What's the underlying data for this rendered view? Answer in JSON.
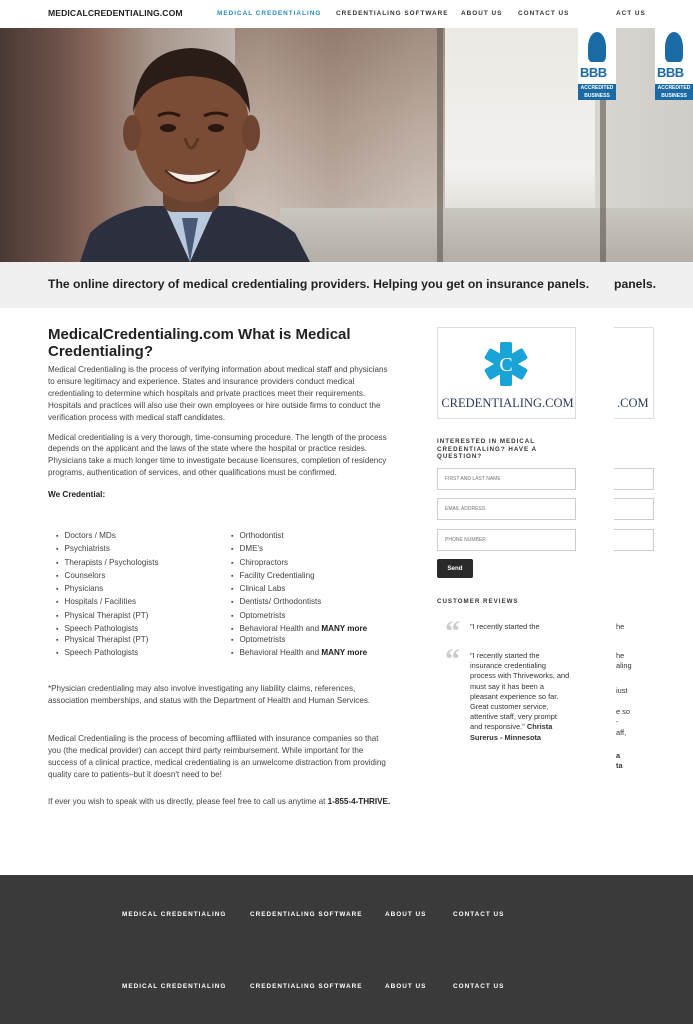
{
  "nav": {
    "brand": "MEDICALCREDENTIALING.COM",
    "links": [
      "MEDICAL CREDENTIALING",
      "CREDENTIALING SOFTWARE",
      "ABOUT US",
      "CONTACT US"
    ],
    "dup_link": "ACT US"
  },
  "hero": {
    "bbb_letters": "BBB",
    "bbb_accredited": "ACCREDITED",
    "bbb_business": "BUSINESS"
  },
  "tagline": "The online directory of medical credentialing providers. Helping you get on insurance panels.",
  "tagline_dup": "panels.",
  "main": {
    "title": "MedicalCredentialing.com What is Medical Credentialing?",
    "para1": "Medical Credentialing is the process of verifying information about medical staff and physicians to ensure legitimacy and experience. States and insurance providers conduct medical credentialing to determine which hospitals and private practices meet their requirements. Hospitals and practices will also use their own employees or hire outside firms to conduct the verification process with medical staff candidates.",
    "para2": "Medical credentialing is a very thorough, time-consuming procedure. The length of the process depends on the applicant and the laws of the state where the hospital or practice resides. Physicians take a much longer time to investigate because licensures, completion of residency programs, authentication of services, and other qualifications must be confirmed.",
    "we_credential": "We Credential:",
    "list_left": [
      "Doctors / MDs",
      "Psychiatrists",
      "Therapists / Psychologists",
      "Counselors",
      "Physicians",
      "Hospitals / Facilities",
      "Physical Therapist (PT)",
      "Speech Pathologists"
    ],
    "list_right": [
      "Orthodontist",
      "DME's",
      "Chiropractors",
      "Facility Credentialing",
      "Clinical Labs",
      "Dentists/ Orthodontists",
      "Optometrists",
      "Behavioral Health and "
    ],
    "list_left2": [
      "Physical Therapist (PT)",
      "Speech Pathologists"
    ],
    "list_right2": [
      "Optometrists",
      "Behavioral Health and "
    ],
    "many_more": "MANY more",
    "para3": "*Physician credentialing may also involve investigating any liability claims, references, association memberships, and status with the Department of Health and Human Services.",
    "para4": "Medical Credentialing is the process of becoming affiliated with insurance companies so that you (the medical provider) can accept third party reimbursement. While important for the success of a clinical practice, medical credentialing is an unwelcome distraction from providing quality care to patients–but it doesn't need to be!",
    "para5_prefix": "If ever you wish to speak with us directly, please feel free to call us anytime at ",
    "phone": "1-855-4-THRIVE."
  },
  "sidebar": {
    "logo_text": "CREDENTIALING.COM",
    "logo_dup": ".COM",
    "form_heading": "INTERESTED IN MEDICAL CREDENTIALING? HAVE A QUESTION?",
    "name_placeholder": "FIRST AND LAST NAME",
    "email_placeholder": "EMAIL ADDRESS",
    "phone_placeholder": "PHONE NUMBER",
    "send_label": "Send",
    "reviews_heading": "CUSTOMER REVIEWS",
    "review_short": "\"I recently started the",
    "review_full": "\"I recently started the insurance credentialing process with Thriveworks, and must say it has been a pleasant experience so far. Great customer service, attentive staff, very prompt and responsive.\"",
    "review_author": "Christa Surerus - Minnesota",
    "dup_lines": [
      "he",
      "he",
      "aling",
      "iust",
      "e so",
      "-",
      "aff,",
      "a",
      "ta"
    ]
  },
  "footer": {
    "links": [
      "MEDICAL CREDENTIALING",
      "CREDENTIALING SOFTWARE",
      "ABOUT US",
      "CONTACT US"
    ]
  },
  "colors": {
    "accent": "#2a8bc0",
    "footer_bg": "#3a3a3a",
    "bbb_blue": "#1a6aa5"
  }
}
